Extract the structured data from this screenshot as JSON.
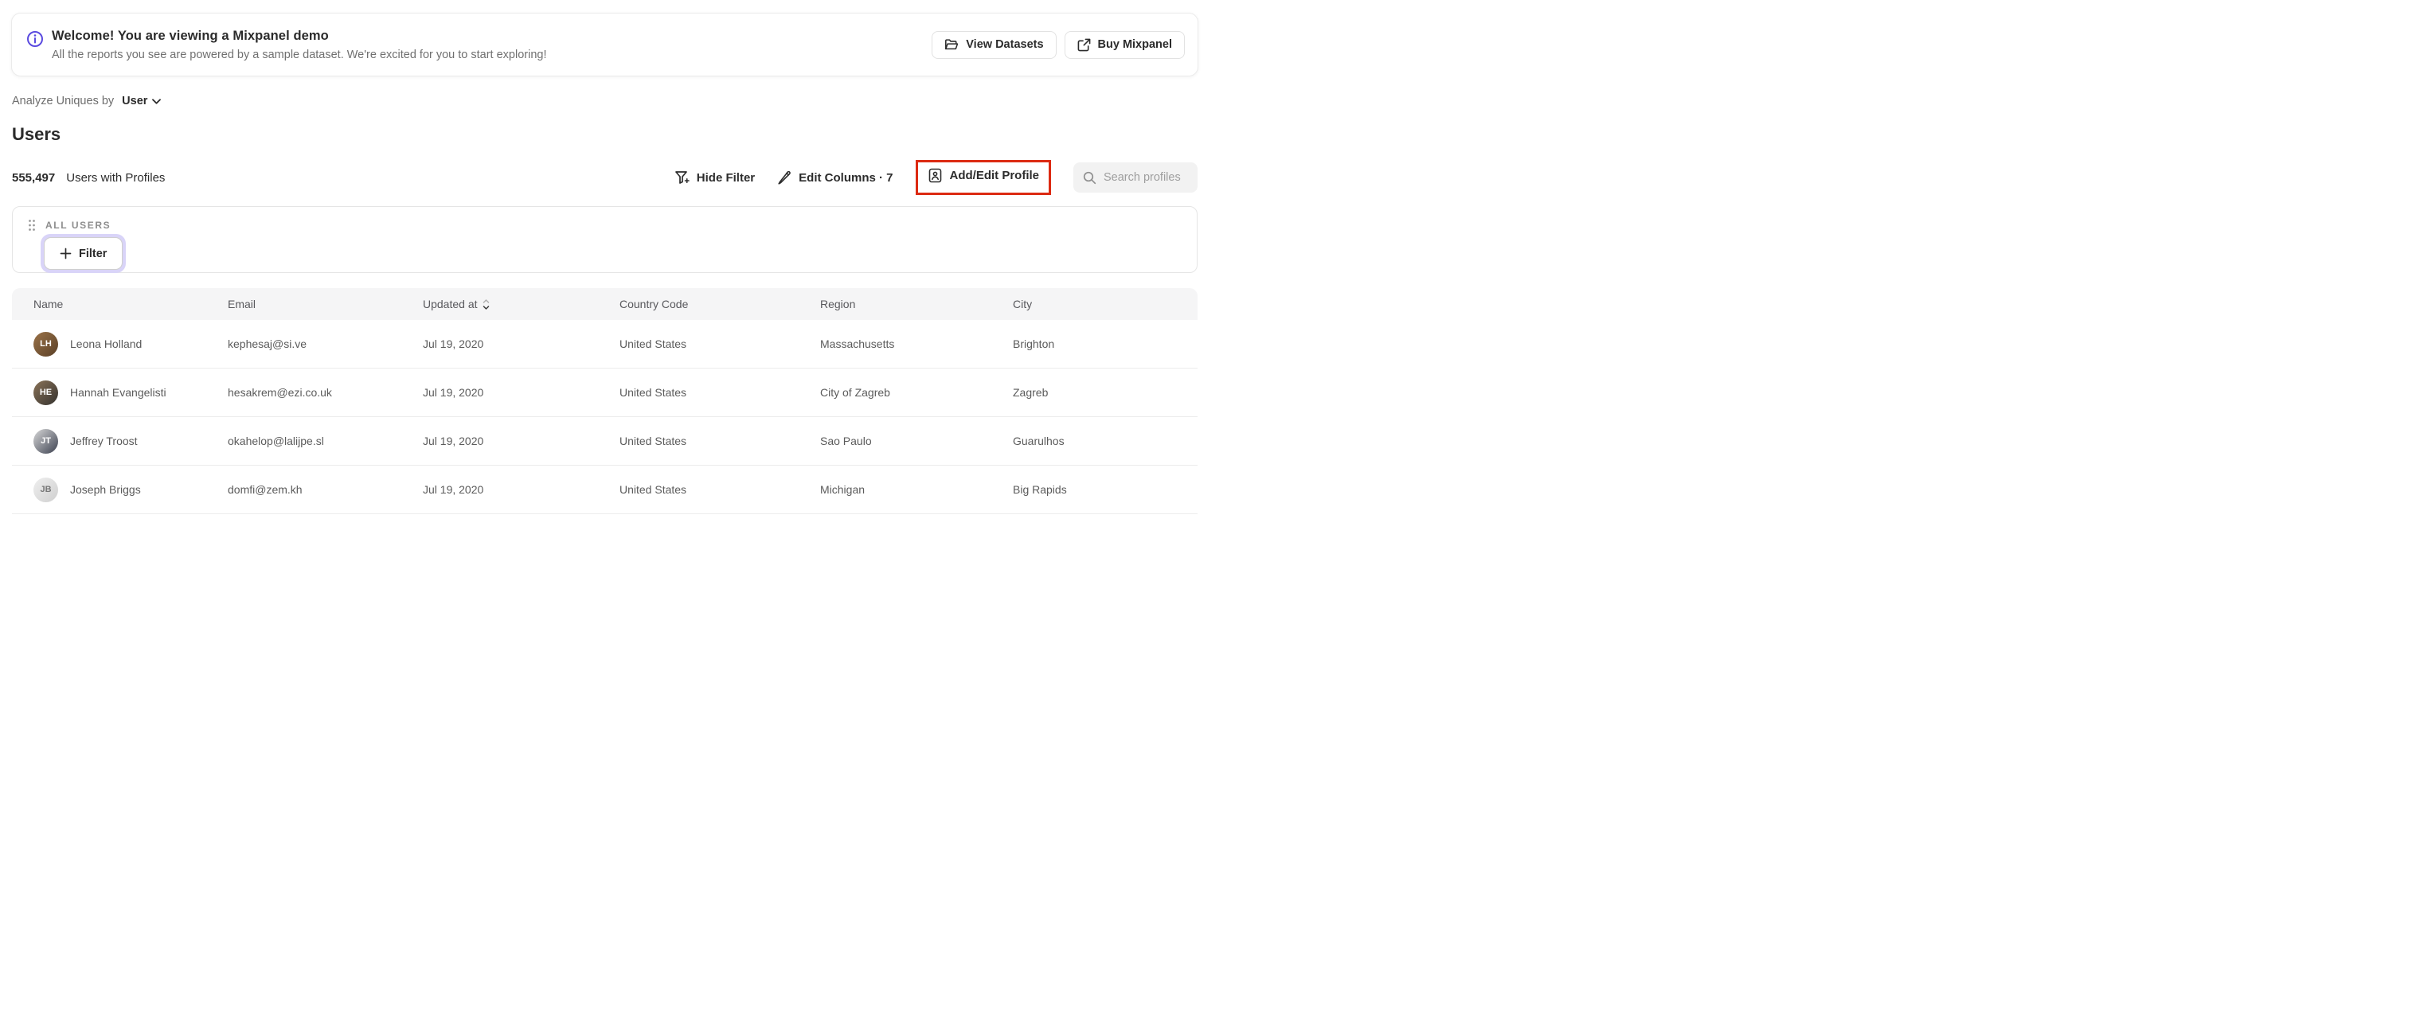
{
  "banner": {
    "title": "Welcome! You are viewing a Mixpanel demo",
    "subtitle": "All the reports you see are powered by a sample dataset. We're excited for you to start exploring!",
    "buttons": [
      {
        "label": "View Datasets",
        "icon": "folder-icon"
      },
      {
        "label": "Buy Mixpanel",
        "icon": "external-link-icon"
      }
    ]
  },
  "analyze": {
    "label": "Analyze Uniques by",
    "selected": "User"
  },
  "page": {
    "title": "Users"
  },
  "stats": {
    "count": "555,497",
    "label": "Users with Profiles"
  },
  "toolbar": {
    "hide_filter_label": "Hide Filter",
    "edit_columns_label": "Edit Columns · 7",
    "add_edit_profile_label": "Add/Edit Profile",
    "search_placeholder": "Search profiles"
  },
  "filter_panel": {
    "group_label": "ALL USERS",
    "filter_button_label": "Filter"
  },
  "table": {
    "columns": {
      "name": "Name",
      "email": "Email",
      "updated_at": "Updated at",
      "country": "Country Code",
      "region": "Region",
      "city": "City"
    },
    "sorted_column": "Updated at",
    "sort_direction": "desc",
    "rows": [
      {
        "name": "Leona Holland",
        "initials": "LH",
        "email": "kephesaj@si.ve",
        "updated_at": "Jul 19, 2020",
        "country": "United States",
        "region": "Massachusetts",
        "city": "Brighton",
        "avatar": {
          "bg1": "#9a7248",
          "bg2": "#5a4027",
          "fg": "#ffffff"
        }
      },
      {
        "name": "Hannah Evangelisti",
        "initials": "HE",
        "email": "hesakrem@ezi.co.uk",
        "updated_at": "Jul 19, 2020",
        "country": "United States",
        "region": "City of Zagreb",
        "city": "Zagreb",
        "avatar": {
          "bg1": "#8a7358",
          "bg2": "#35322f",
          "fg": "#ffffff"
        }
      },
      {
        "name": "Jeffrey Troost",
        "initials": "JT",
        "email": "okahelop@lalijpe.sl",
        "updated_at": "Jul 19, 2020",
        "country": "United States",
        "region": "Sao Paulo",
        "city": "Guarulhos",
        "avatar": {
          "bg1": "#d8d8d8",
          "bg2": "#3c4150",
          "fg": "#ffffff"
        }
      },
      {
        "name": "Joseph Briggs",
        "initials": "JB",
        "email": "domfi@zem.kh",
        "updated_at": "Jul 19, 2020",
        "country": "United States",
        "region": "Michigan",
        "city": "Big Rapids",
        "avatar": {
          "bg1": "#efefef",
          "bg2": "#cfcfcf",
          "fg": "#777777"
        }
      }
    ]
  },
  "colors": {
    "accent_indigo": "#5b4be0",
    "annotation_red": "#dc2a12",
    "filter_ring_lavender": "#d9d4f8",
    "table_header_bg": "#f5f5f6",
    "search_bg": "#f2f2f2"
  }
}
